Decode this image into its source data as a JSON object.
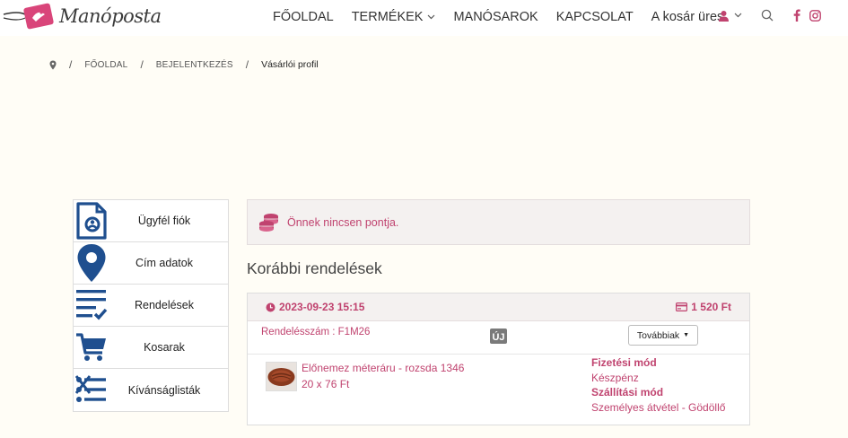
{
  "header": {
    "logo_text": "Manóposta",
    "nav": [
      {
        "label": "FŐOLDAL"
      },
      {
        "label": "TERMÉKEK"
      },
      {
        "label": "MANÓSAROK"
      },
      {
        "label": "KAPCSOLAT"
      },
      {
        "label": "A kosár üres"
      }
    ],
    "icons": [
      "user-icon",
      "chevron-down-icon",
      "search-icon",
      "facebook-icon",
      "instagram-icon"
    ]
  },
  "breadcrumb": {
    "items": [
      "FŐOLDAL",
      "BEJELENTKEZÉS"
    ],
    "current": "Vásárlói profil",
    "separator": "/"
  },
  "sidebar": {
    "items": [
      {
        "label": "Ügyfél fiók",
        "icon": "account-document-icon"
      },
      {
        "label": "Cím adatok",
        "icon": "map-pin-icon"
      },
      {
        "label": "Rendelések",
        "icon": "checklist-icon"
      },
      {
        "label": "Kosarak",
        "icon": "cart-icon"
      },
      {
        "label": "Kívánságlisták",
        "icon": "wishlist-icon"
      }
    ]
  },
  "points": {
    "text": "Önnek nincsen pontja.",
    "icon": "coins-icon"
  },
  "orders": {
    "title": "Korábbi rendelések",
    "list": [
      {
        "date": "2023-09-23 15:15",
        "total": "1 520 Ft",
        "number": "Rendelésszám : F1M26",
        "status_badge": "ÚJ",
        "more_label": "Továbbiak",
        "item_name": "Előnemez méteráru - rozsda 1346",
        "item_price": "20 x 76 Ft",
        "payment_label": "Fizetési mód",
        "payment_value": "Készpénz",
        "shipping_label": "Szállítási mód",
        "shipping_value": "Személyes átvétel - Gödöllő"
      }
    ]
  },
  "colors": {
    "accent": "#c0436f",
    "icon_blue": "#1f4f8f",
    "background": "#fffdf6",
    "panel": "#f4f1f0"
  }
}
